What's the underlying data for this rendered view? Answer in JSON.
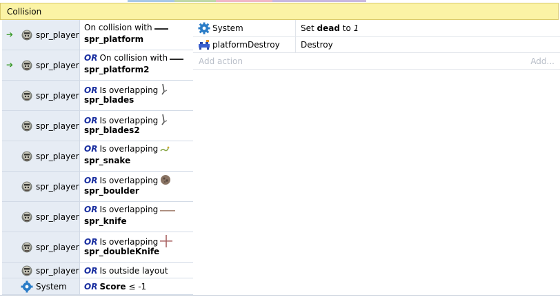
{
  "group": {
    "title": "Collision"
  },
  "conditions": [
    {
      "object": "spr_player",
      "trigger": true,
      "or": false,
      "text": "On collision with",
      "target": "spr_platform",
      "icon": "player-sprite-icon",
      "mini": "platform-icon"
    },
    {
      "object": "spr_player",
      "trigger": true,
      "or": true,
      "or_label": "OR",
      "text": "On collision with",
      "target": "spr_platform2",
      "icon": "player-sprite-icon",
      "mini": "platform-icon"
    },
    {
      "object": "spr_player",
      "trigger": false,
      "or": true,
      "or_label": "OR",
      "text": "Is overlapping",
      "target": "spr_blades",
      "icon": "player-sprite-icon",
      "mini": "blade-icon"
    },
    {
      "object": "spr_player",
      "trigger": false,
      "or": true,
      "or_label": "OR",
      "text": "Is overlapping",
      "target": "spr_blades2",
      "icon": "player-sprite-icon",
      "mini": "blade-icon"
    },
    {
      "object": "spr_player",
      "trigger": false,
      "or": true,
      "or_label": "OR",
      "text": "Is overlapping",
      "target": "spr_snake",
      "icon": "player-sprite-icon",
      "mini": "snake-icon"
    },
    {
      "object": "spr_player",
      "trigger": false,
      "or": true,
      "or_label": "OR",
      "text": "Is overlapping",
      "target": "spr_boulder",
      "icon": "player-sprite-icon",
      "mini": "boulder-icon"
    },
    {
      "object": "spr_player",
      "trigger": false,
      "or": true,
      "or_label": "OR",
      "text": "Is overlapping",
      "target": "spr_knife",
      "icon": "player-sprite-icon",
      "mini": "knife-icon"
    },
    {
      "object": "spr_player",
      "trigger": false,
      "or": true,
      "or_label": "OR",
      "text": "Is overlapping",
      "target": "spr_doubleKnife",
      "icon": "player-sprite-icon",
      "mini": "double-knife-icon"
    },
    {
      "object": "spr_player",
      "trigger": false,
      "or": true,
      "or_label": "OR",
      "text": "Is outside layout",
      "target": "",
      "icon": "player-sprite-icon",
      "mini": ""
    },
    {
      "object": "System",
      "trigger": false,
      "or": true,
      "or_label": "OR",
      "text": "",
      "var": "Score",
      "cmp": "≤ -1",
      "icon": "gear-icon",
      "mini": ""
    }
  ],
  "actions": [
    {
      "object": "System",
      "icon": "gear-icon",
      "pre": "Set ",
      "var": "dead",
      "mid": " to ",
      "val": "1"
    },
    {
      "object": "platformDestroy",
      "icon": "platform-destroy-icon",
      "text": "Destroy"
    }
  ],
  "add_row": {
    "add_action": "Add action",
    "add_more": "Add..."
  },
  "colors": {
    "header_bg": "#fbf3a5",
    "cond_bg": "#e6ecf4",
    "or_color": "#1a2fa0",
    "trigger_arrow": "#3a9a2a"
  }
}
